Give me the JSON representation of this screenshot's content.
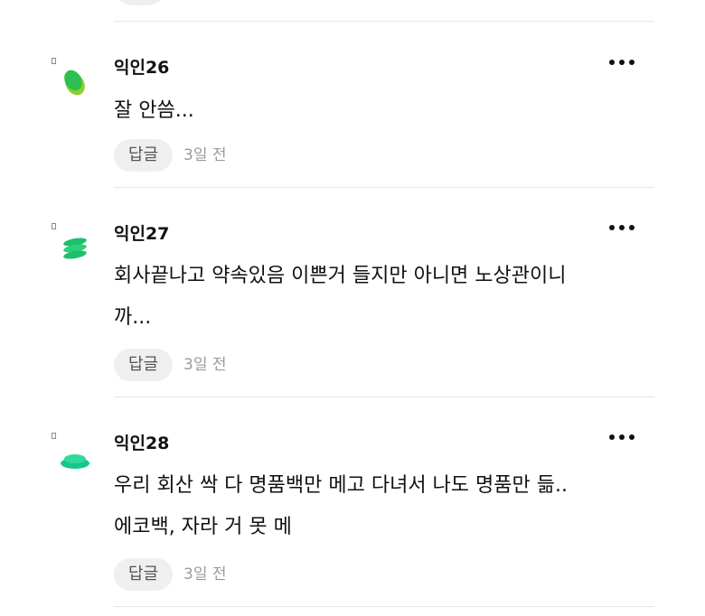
{
  "comments": [
    {
      "author": "익인26",
      "text": "잘 안씀...",
      "reply_label": "답글",
      "time": "3일 전",
      "avatar_icon": "green-blob-avatar-icon",
      "avatar_colors": [
        "#2dbf4f",
        "#8ed12f"
      ]
    },
    {
      "author": "익인27",
      "text": "회사끝나고 약속있음 이쁜거 들지만 아니면 노상관이니\n까...",
      "reply_label": "답글",
      "time": "3일 전",
      "avatar_icon": "green-stack-avatar-icon",
      "avatar_colors": [
        "#1fbf6a",
        "#2ccf7a"
      ]
    },
    {
      "author": "익인28",
      "text": "우리 회산 싹 다 명품백만 메고 다녀서 나도 명품만 듦..\n에코백, 자라 거 못 메",
      "reply_label": "답글",
      "time": "3일 전",
      "avatar_icon": "teal-disc-avatar-icon",
      "avatar_colors": [
        "#14c88a",
        "#32d99c"
      ]
    }
  ]
}
